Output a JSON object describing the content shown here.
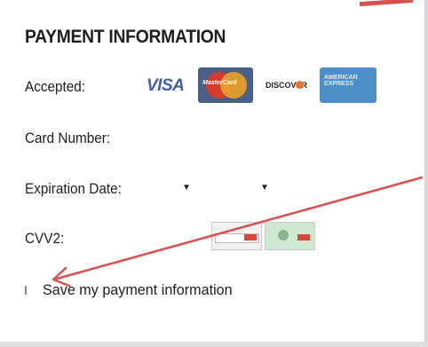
{
  "section": {
    "title": "PAYMENT INFORMATION"
  },
  "accepted": {
    "label": "Accepted:",
    "cards": [
      "VISA",
      "MasterCard",
      "DISCOVER",
      "AMERICAN EXPRESS"
    ]
  },
  "card_number": {
    "label": "Card Number:"
  },
  "expiration": {
    "label": "Expiration Date:"
  },
  "cvv": {
    "label": "CVV2:"
  },
  "save": {
    "label": "Save my payment information"
  },
  "colors": {
    "annotation_arrow": "#d9514e"
  }
}
